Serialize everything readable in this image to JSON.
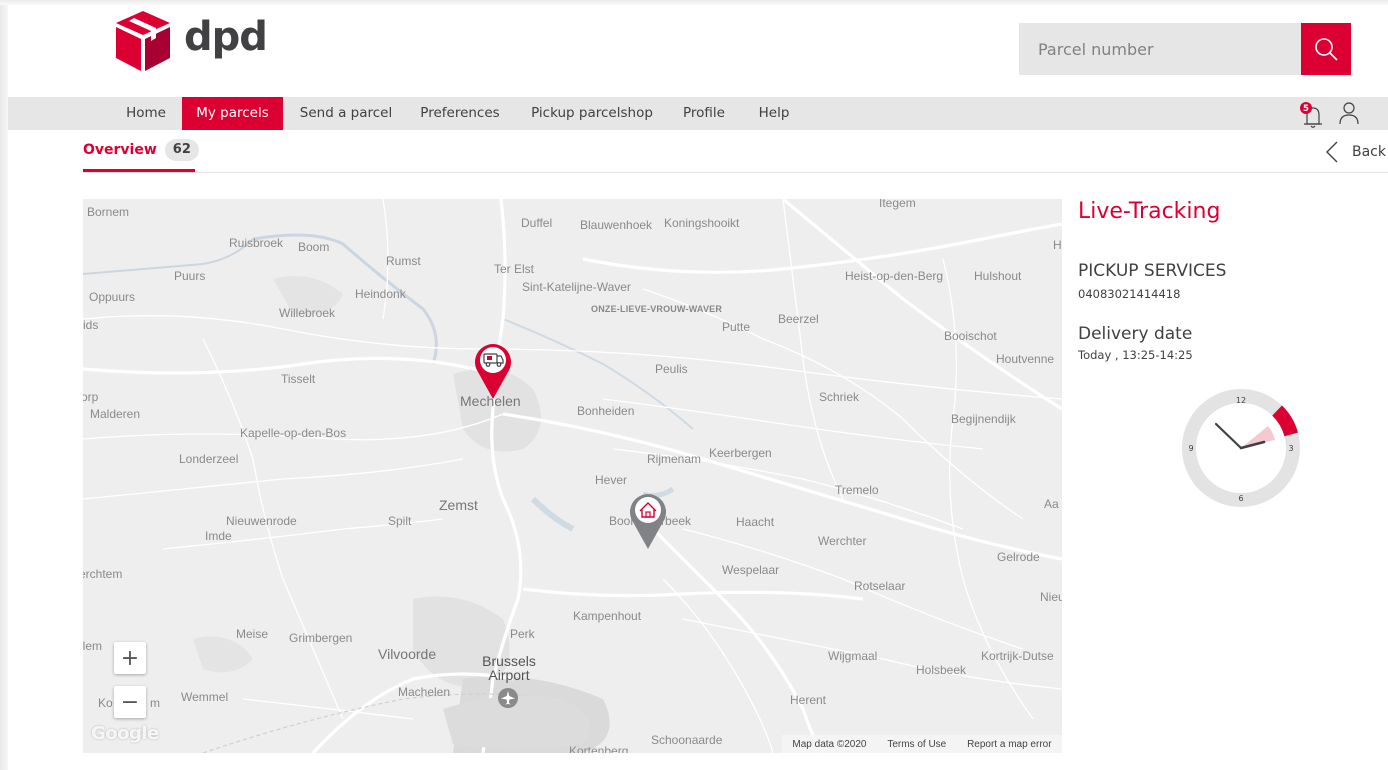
{
  "brand": {
    "name": "dpd",
    "color": "#dc0032"
  },
  "header": {
    "search": {
      "placeholder": "Parcel number",
      "button_icon": "search-icon"
    }
  },
  "nav": {
    "items": [
      {
        "label": "Home",
        "active": false
      },
      {
        "label": "My parcels",
        "active": true
      },
      {
        "label": "Send a parcel",
        "active": false
      },
      {
        "label": "Preferences",
        "active": false
      },
      {
        "label": "Pickup parcelshop",
        "active": false
      },
      {
        "label": "Profile",
        "active": false
      },
      {
        "label": "Help",
        "active": false
      }
    ],
    "notifications": {
      "icon": "bell-icon",
      "count": "5"
    },
    "account_icon": "user-icon"
  },
  "tabs": {
    "overview": {
      "label": "Overview",
      "count": "62"
    },
    "back_label": "Back"
  },
  "map": {
    "labels": {
      "bornem": "Bornem",
      "ruisbroek": "Ruisbroek",
      "boom": "Boom",
      "rumst": "Rumst",
      "duffel": "Duffel",
      "blauwenhoek": "Blauwenhoek",
      "koningshooikt": "Koningshooikt",
      "itegem": "Itegem",
      "puurs": "Puurs",
      "oppuurs": "Oppuurs",
      "heindonk": "Heindonk",
      "ter_elst": "Ter Elst",
      "sint_katelijne": "Sint-Katelijne-Waver",
      "olv_waver": "ONZE-LIEVE-VROUW-WAVER",
      "heist": "Heist-op-den-Berg",
      "hulshout": "Hulshout",
      "willebroek": "Willebroek",
      "putte": "Putte",
      "beerzel": "Beerzel",
      "booischot": "Booischot",
      "houtvenne": "Houtvenne",
      "ids": "ids",
      "tisselt": "Tisselt",
      "peulis": "Peulis",
      "mechelen": "Mechelen",
      "malderen": "Malderen",
      "orp": "orp",
      "bonheiden": "Bonheiden",
      "schriek": "Schriek",
      "begijnendijk": "Begijnendijk",
      "kapelle": "Kapelle-op-den-Bos",
      "londerzeel": "Londerzeel",
      "rijmenam": "Rijmenam",
      "keerbergen": "Keerbergen",
      "hever": "Hever",
      "tremelo": "Tremelo",
      "zemst": "Zemst",
      "nieuwenrode": "Nieuwenrode",
      "spilt": "Spilt",
      "boortmeerbeek": "Boortmeerbeek",
      "haacht": "Haacht",
      "imde": "Imde",
      "werchter": "Werchter",
      "gelrode": "Gelrode",
      "erchtem": "erchtem",
      "wespelaar": "Wespelaar",
      "rotselaar": "Rotselaar",
      "aa": "Aa",
      "nieu": "Nieu",
      "kampenhout": "Kampenhout",
      "meise": "Meise",
      "grimbergen": "Grimbergen",
      "perk": "Perk",
      "vilvoorde": "Vilvoorde",
      "brussels_airport": "Brussels Airport",
      "wijgmaal": "Wijgmaal",
      "kortrijk_dutsel": "Kortrijk-Dutse",
      "holsbeek": "Holsbeek",
      "llem": "llem",
      "machelen": "Machelen",
      "wemmel": "Wemmel",
      "ko": "Ko",
      "m": "m",
      "herent": "Herent",
      "schoonaarde": "Schoonaarde",
      "kortenberg": "Kortenberg",
      "h": "H"
    },
    "zoom_in": "+",
    "zoom_out": "−",
    "google": "Google",
    "footer": {
      "data": "Map data ©2020",
      "terms": "Terms of Use",
      "report": "Report a map error"
    },
    "markers": [
      {
        "name": "courier-van-marker",
        "icon": "van-icon",
        "color": "#dc0032"
      },
      {
        "name": "home-destination-marker",
        "icon": "home-icon",
        "color": "#808285"
      }
    ]
  },
  "tracking": {
    "title": "Live-Tracking",
    "service": "PICKUP SERVICES",
    "parcel_number": "04083021414418",
    "delivery_label": "Delivery date",
    "delivery_value": "Today , 13:25-14:25",
    "clock": {
      "n12": "12",
      "n3": "3",
      "n6": "6",
      "n9": "9"
    }
  }
}
